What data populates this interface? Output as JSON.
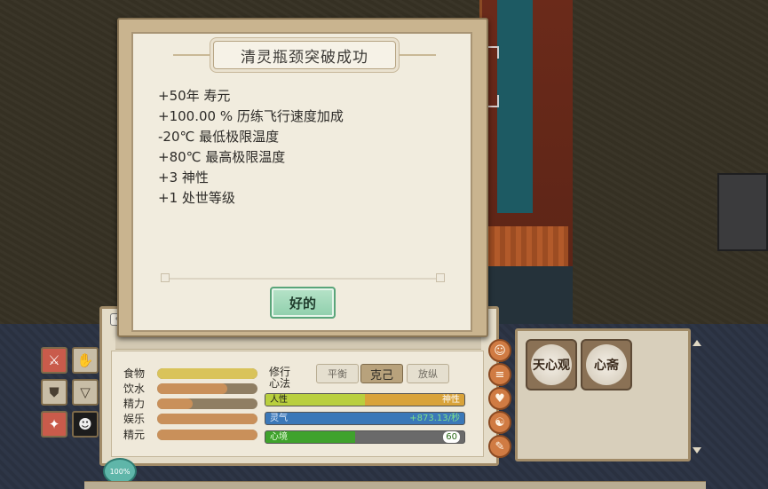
{
  "dialog": {
    "title": "清灵瓶颈突破成功",
    "lines": [
      "+50年  寿元",
      "+100.00 %  历练飞行速度加成",
      "-20℃  最低极限温度",
      "+80℃  最高极限温度",
      "+3  神性",
      "+1  处世等级"
    ],
    "ok_label": "好的"
  },
  "needs": {
    "food": {
      "label": "食物",
      "level": 1.0,
      "color": "#d9c35a"
    },
    "water": {
      "label": "饮水",
      "level": 0.7,
      "color": "#c9905a"
    },
    "energy": {
      "label": "精力",
      "level": 0.35,
      "color": "#c9905a"
    },
    "fun": {
      "label": "娱乐",
      "level": 1.0,
      "color": "#c9905a"
    },
    "essence": {
      "label": "精元",
      "level": 1.0,
      "color": "#c9905a"
    }
  },
  "cultivation": {
    "label": "修行心法",
    "tabs": [
      "平衡",
      "克己",
      "放纵"
    ],
    "active_tab": "克己",
    "humanity_label": "人性",
    "divinity_label": "神性",
    "humanity_level": 0.5,
    "spirit_label": "灵气",
    "spirit_rate": "+873.13/秒",
    "mood_label": "心境",
    "mood_value": "60",
    "mood_level": 0.45
  },
  "skills": [
    {
      "label": "天心观"
    },
    {
      "label": "心斋"
    }
  ],
  "hud": {
    "percent": "100%"
  },
  "icons": {
    "left_column": [
      "sword-icon",
      "hand-icon",
      "shield-icon",
      "cup-icon",
      "person-icon",
      "figure-icon"
    ],
    "side_column": [
      "portrait-icon",
      "list-icon",
      "heart-icon",
      "yinyang-icon",
      "scroll-icon"
    ]
  }
}
